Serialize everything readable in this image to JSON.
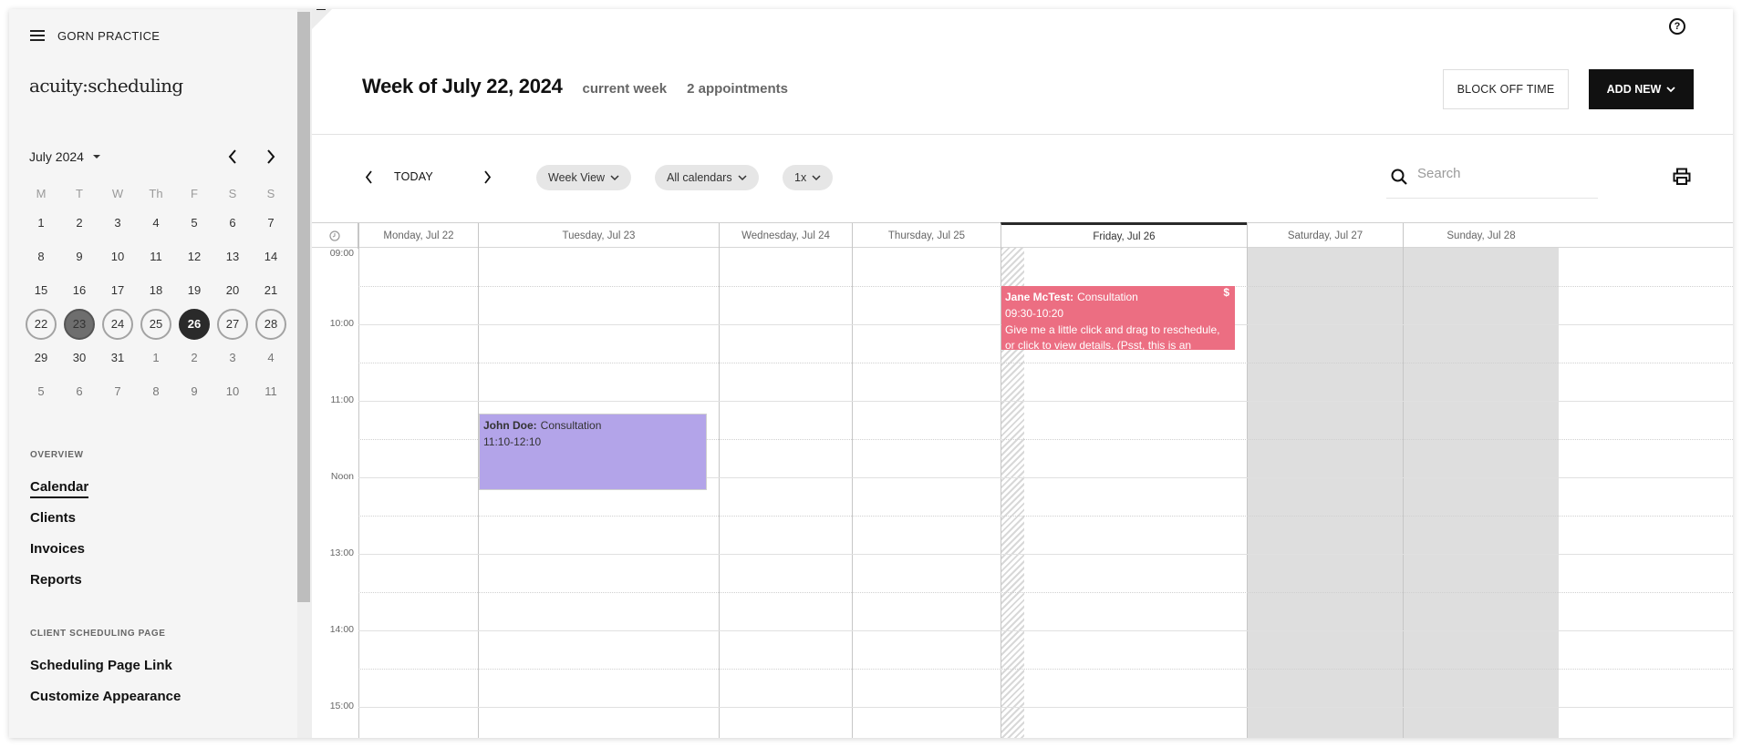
{
  "sidebar": {
    "practice_name": "GORN PRACTICE",
    "logo_text": "acuity:scheduling",
    "mini_calendar": {
      "month_label": "July 2024",
      "weekdays": [
        "M",
        "T",
        "W",
        "Th",
        "F",
        "S",
        "S"
      ],
      "weeks": [
        [
          {
            "d": "1"
          },
          {
            "d": "2"
          },
          {
            "d": "3"
          },
          {
            "d": "4"
          },
          {
            "d": "5"
          },
          {
            "d": "6"
          },
          {
            "d": "7"
          }
        ],
        [
          {
            "d": "8"
          },
          {
            "d": "9"
          },
          {
            "d": "10"
          },
          {
            "d": "11"
          },
          {
            "d": "12"
          },
          {
            "d": "13"
          },
          {
            "d": "14"
          }
        ],
        [
          {
            "d": "15"
          },
          {
            "d": "16"
          },
          {
            "d": "17"
          },
          {
            "d": "18"
          },
          {
            "d": "19"
          },
          {
            "d": "20"
          },
          {
            "d": "21"
          }
        ],
        [
          {
            "d": "22",
            "state": "week"
          },
          {
            "d": "23",
            "state": "selected"
          },
          {
            "d": "24",
            "state": "week"
          },
          {
            "d": "25",
            "state": "week"
          },
          {
            "d": "26",
            "state": "today"
          },
          {
            "d": "27",
            "state": "week"
          },
          {
            "d": "28",
            "state": "week"
          }
        ],
        [
          {
            "d": "29"
          },
          {
            "d": "30"
          },
          {
            "d": "31"
          },
          {
            "d": "1",
            "state": "other"
          },
          {
            "d": "2",
            "state": "other"
          },
          {
            "d": "3",
            "state": "other"
          },
          {
            "d": "4",
            "state": "other"
          }
        ],
        [
          {
            "d": "5",
            "state": "other"
          },
          {
            "d": "6",
            "state": "other"
          },
          {
            "d": "7",
            "state": "other"
          },
          {
            "d": "8",
            "state": "other"
          },
          {
            "d": "9",
            "state": "other"
          },
          {
            "d": "10",
            "state": "other"
          },
          {
            "d": "11",
            "state": "other"
          }
        ]
      ]
    },
    "overview_label": "OVERVIEW",
    "nav": [
      {
        "label": "Calendar",
        "active": true
      },
      {
        "label": "Clients"
      },
      {
        "label": "Invoices"
      },
      {
        "label": "Reports"
      }
    ],
    "client_section_label": "CLIENT SCHEDULING PAGE",
    "client_links": [
      {
        "label": "Scheduling Page Link"
      },
      {
        "label": "Customize Appearance"
      }
    ]
  },
  "header": {
    "title": "Week of July 22, 2024",
    "subtitle_week": "current week",
    "appointment_count": "2 appointments",
    "block_off_label": "BLOCK OFF TIME",
    "add_new_label": "ADD NEW",
    "help_icon": "?"
  },
  "toolbar": {
    "today_label": "TODAY",
    "view_select": "Week View",
    "calendar_select": "All calendars",
    "zoom_select": "1x",
    "search_placeholder": "Search",
    "search_value": ""
  },
  "calendar": {
    "days": [
      {
        "label": "Monday, Jul 22"
      },
      {
        "label": "Tuesday, Jul 23"
      },
      {
        "label": "Wednesday, Jul 24"
      },
      {
        "label": "Thursday, Jul 25"
      },
      {
        "label": "Friday, Jul 26",
        "today": true
      },
      {
        "label": "Saturday, Jul 27",
        "weekend": true
      },
      {
        "label": "Sunday, Jul 28",
        "weekend": true
      }
    ],
    "hours": [
      "09:00",
      "10:00",
      "11:00",
      "Noon",
      "13:00",
      "14:00",
      "15:00"
    ],
    "appointments": [
      {
        "client": "John Doe:",
        "type": "Consultation",
        "time": "11:10-12:10",
        "note": "",
        "day_index": 1,
        "start": "11:10",
        "end": "12:10",
        "color": "#b3a4e9",
        "paid_icon": ""
      },
      {
        "client": "Jane McTest:",
        "type": "Consultation",
        "time": "09:30-10:20",
        "note": "Give me a little click and drag to reschedule, or click to view details. (Psst, this is an example appointment.",
        "day_index": 4,
        "start": "09:30",
        "end": "10:20",
        "color": "#ec6e82",
        "paid_icon": "$"
      }
    ]
  }
}
